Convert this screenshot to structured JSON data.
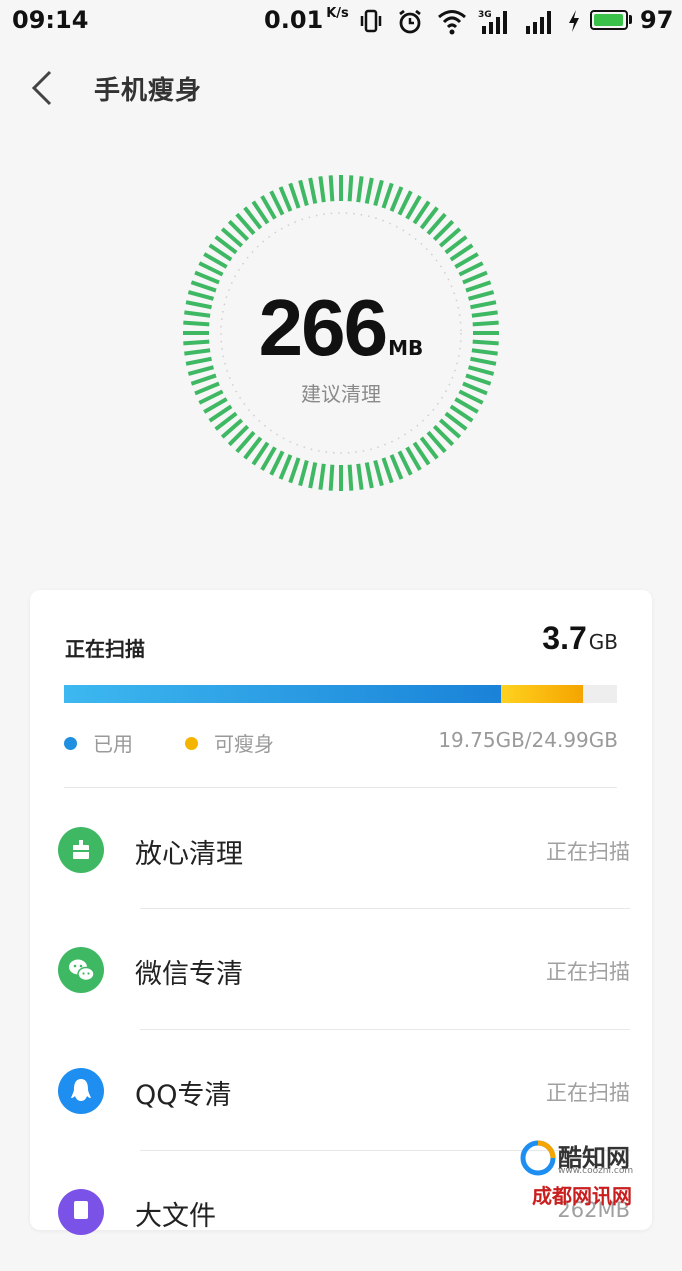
{
  "status_bar": {
    "time": "09:14",
    "net_speed": "0.01",
    "net_speed_unit": "K/s",
    "battery_percent": "97",
    "battery_level": 0.97,
    "icons": [
      "vibrate-icon",
      "alarm-icon",
      "wifi-icon",
      "signal-3g-icon",
      "signal-icon",
      "charging-icon",
      "battery-icon"
    ]
  },
  "header": {
    "title": "手机瘦身",
    "back_icon": "chevron-left-icon"
  },
  "gauge": {
    "value": "266",
    "unit": "MB",
    "label": "建议清理",
    "color": "#3fb863"
  },
  "scan": {
    "title": "正在扫描",
    "size_value": "3.7",
    "size_unit": "GB",
    "used_fraction": 0.79,
    "slimmable_fraction": 0.148,
    "used_color": "#1f8fe0",
    "slimmable_color": "#f5b400",
    "legend_used": "已用",
    "legend_slimmable": "可瘦身",
    "storage_text": "19.75GB/24.99GB"
  },
  "items": [
    {
      "label": "放心清理",
      "status": "正在扫描",
      "icon": "broom-icon",
      "color": "#3fb863"
    },
    {
      "label": "微信专清",
      "status": "正在扫描",
      "icon": "wechat-icon",
      "color": "#3fb863"
    },
    {
      "label": "QQ专清",
      "status": "正在扫描",
      "icon": "qq-penguin-icon",
      "color": "#1e8ef0"
    },
    {
      "label": "大文件",
      "status": "262MB",
      "icon": "file-icon",
      "color": "#7b52e8"
    }
  ],
  "watermark": {
    "text1": "酷知网",
    "text2": "www.coozhi.com",
    "text3": "成都网讯网"
  }
}
